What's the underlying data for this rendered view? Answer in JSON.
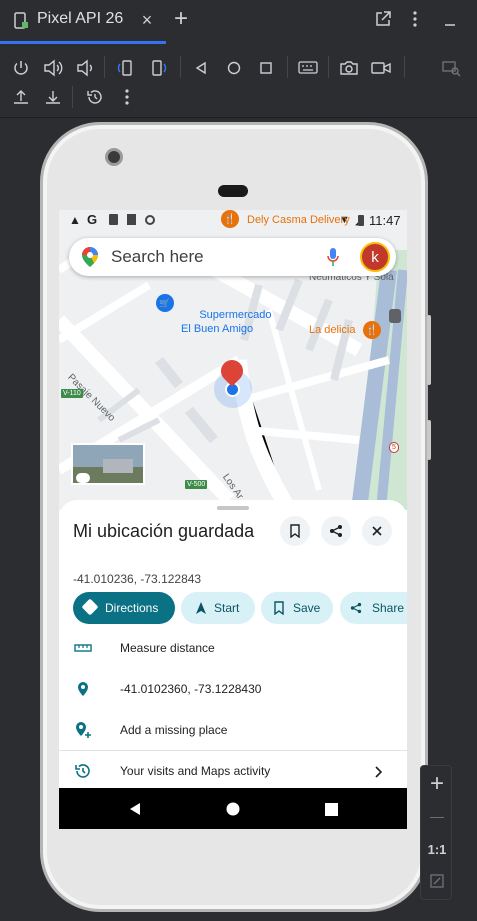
{
  "ide": {
    "tab_title": "Pixel API 26",
    "tab_close": "×",
    "new_tab": "+",
    "toolbar_icons": [
      "power-icon",
      "volume-up-icon",
      "volume-down-icon",
      "rotate-left-icon",
      "rotate-right-icon",
      "back-icon",
      "home-icon",
      "overview-icon",
      "keyboard-icon",
      "camera-icon",
      "record-video-icon",
      "screen-mirror-icon",
      "upload-icon",
      "download-icon",
      "snapshot-history-icon",
      "more-vert-icon"
    ],
    "zoom": {
      "zoom_in": "+",
      "zoom_out": "—",
      "actual_size": "1:1"
    }
  },
  "device": {
    "statusbar": {
      "time": "11:47"
    },
    "search": {
      "placeholder": "Search here",
      "avatar_letter": "k"
    },
    "map": {
      "places": [
        {
          "name": "Dely Casma Delivery",
          "color": "#e8710a"
        },
        {
          "name": "Neumáticos Y Sola",
          "color": "#5f6368"
        },
        {
          "name": "Supermercado\nEl Buen Amigo",
          "color": "#1a73e8"
        },
        {
          "name": "La delicia",
          "color": "#e8710a"
        }
      ],
      "streets": [
        "Pasaje Nuevo",
        "Los Ar"
      ],
      "road_signs": [
        "V-110",
        "V-500",
        "5"
      ]
    },
    "place": {
      "title": "Mi ubicación guardada",
      "coords": "-41.010236, -73.122843",
      "chips": [
        {
          "label": "Directions",
          "icon": "directions-icon",
          "style": "primary"
        },
        {
          "label": "Start",
          "icon": "navigation-icon",
          "style": "tonal"
        },
        {
          "label": "Save",
          "icon": "bookmark-icon",
          "style": "tonal"
        },
        {
          "label": "Share",
          "icon": "share-icon",
          "style": "tonal"
        }
      ],
      "rows": [
        {
          "label": "Measure distance",
          "icon": "ruler-icon"
        },
        {
          "label": "-41.0102360, -73.1228430",
          "icon": "location-pin-icon"
        },
        {
          "label": "Add a missing place",
          "icon": "add-place-icon"
        },
        {
          "label": "Your visits and Maps activity",
          "icon": "history-icon"
        }
      ]
    },
    "colors": {
      "accent": "#0b7285",
      "tonal": "#d7f1f6",
      "marker_red": "#db4437",
      "my_location_blue": "#1a73e8"
    }
  }
}
